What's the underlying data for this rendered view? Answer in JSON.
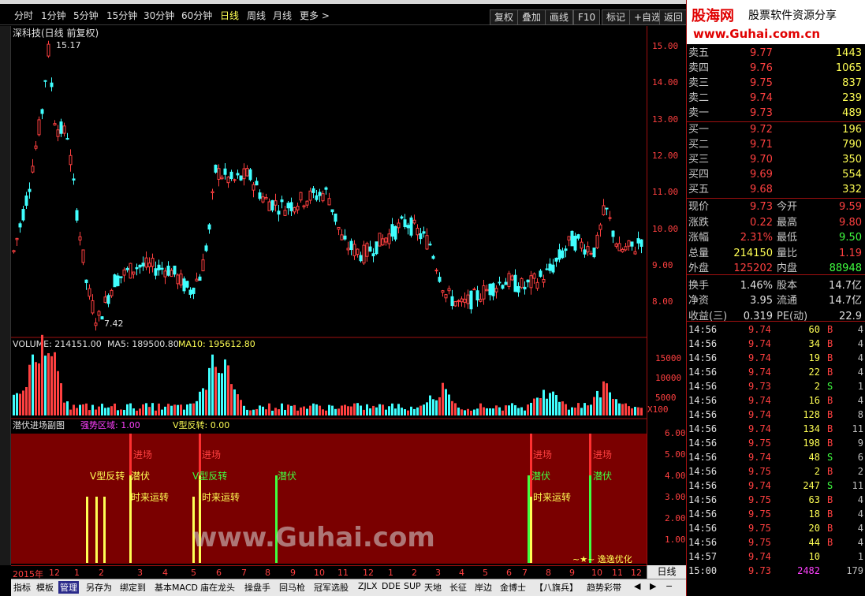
{
  "toolbar": {
    "periods": [
      "分时",
      "1分钟",
      "5分钟",
      "15分钟",
      "30分钟",
      "60分钟",
      "日线",
      "周线",
      "月线",
      "更多 >"
    ],
    "active_period": "日线",
    "right_buttons": [
      "复权",
      "叠加",
      "画线",
      "F10",
      "标记",
      "+自选",
      "返回"
    ]
  },
  "chart": {
    "title": "深科技(日线 前复权)",
    "high_label": "15.17",
    "low_label": "7.42",
    "price_ticks": [
      "15.00",
      "14.00",
      "13.00",
      "12.00",
      "11.00",
      "10.00",
      "9.00",
      "8.00"
    ],
    "volume_header": {
      "volume": "VOLUME: 214151.00",
      "ma5": "MA5: 189500.80",
      "ma10": "MA10: 195612.80"
    },
    "volume_ticks": [
      "15000",
      "10000",
      "5000",
      "X100"
    ],
    "sub_header": {
      "name": "潜伏进场副图",
      "s1": "强势区域: 1.00",
      "s2": "V型反转: 0.00"
    },
    "sub_ticks": [
      "6.00",
      "5.00",
      "4.00",
      "3.00",
      "2.00",
      "1.00"
    ],
    "signals": [
      "进场",
      "进场",
      "进场",
      "进场",
      "潜伏",
      "潜伏",
      "潜伏",
      "潜伏",
      "V型反转",
      "V型反转",
      "时来运转",
      "时来运转",
      "时来运转"
    ],
    "optimize_note": "~★~ 逸逸优化",
    "watermark": "www.Guhai.com",
    "date_labels": [
      "2015年",
      "12",
      "1",
      "2",
      "3",
      "4",
      "5",
      "6",
      "7",
      "8",
      "9",
      "10",
      "11",
      "12",
      "1",
      "2",
      "3",
      "4",
      "5",
      "6",
      "7",
      "8",
      "9",
      "10",
      "11",
      "12"
    ],
    "period_label": "日线"
  },
  "bottom_tabs": [
    "指标",
    "模板",
    "管理",
    "另存为",
    "绑定到",
    "基本MACD",
    "庙在龙头",
    "操盘手",
    "回马枪",
    "冠军选股",
    "ZJLX",
    "DDE",
    "SUP",
    "天地",
    "长征",
    "岸边",
    "金博士",
    "【八旗兵】",
    "趋势彩带"
  ],
  "active_bottom_tab": "管理",
  "ad": {
    "brand": "股海网",
    "slogan": "股票软件资源分享",
    "url": "www.Guhai.com.cn"
  },
  "orderbook": {
    "asks": [
      {
        "label": "卖五",
        "price": "9.77",
        "vol": "1443"
      },
      {
        "label": "卖四",
        "price": "9.76",
        "vol": "1065"
      },
      {
        "label": "卖三",
        "price": "9.75",
        "vol": "837"
      },
      {
        "label": "卖二",
        "price": "9.74",
        "vol": "239"
      },
      {
        "label": "卖一",
        "price": "9.73",
        "vol": "489"
      }
    ],
    "bids": [
      {
        "label": "买一",
        "price": "9.72",
        "vol": "196"
      },
      {
        "label": "买二",
        "price": "9.71",
        "vol": "790"
      },
      {
        "label": "买三",
        "price": "9.70",
        "vol": "350"
      },
      {
        "label": "买四",
        "price": "9.69",
        "vol": "554"
      },
      {
        "label": "买五",
        "price": "9.68",
        "vol": "332"
      }
    ]
  },
  "stats": [
    {
      "k1": "现价",
      "v1": "9.73",
      "c1": "#ff4040",
      "k2": "今开",
      "v2": "9.59",
      "c2": "#ff4040"
    },
    {
      "k1": "涨跌",
      "v1": "0.22",
      "c1": "#ff4040",
      "k2": "最高",
      "v2": "9.80",
      "c2": "#ff4040"
    },
    {
      "k1": "涨幅",
      "v1": "2.31%",
      "c1": "#ff4040",
      "k2": "最低",
      "v2": "9.50",
      "c2": "#40ff40"
    },
    {
      "k1": "总量",
      "v1": "214150",
      "c1": "#ffff54",
      "k2": "量比",
      "v2": "1.19",
      "c2": "#ff4040"
    },
    {
      "k1": "外盘",
      "v1": "125202",
      "c1": "#ff4040",
      "k2": "内盘",
      "v2": "88948",
      "c2": "#40ff40"
    },
    {
      "k1": "换手",
      "v1": "1.46%",
      "c1": "#e0e0e0",
      "k2": "股本",
      "v2": "14.7亿",
      "c2": "#e0e0e0"
    },
    {
      "k1": "净资",
      "v1": "3.95",
      "c1": "#e0e0e0",
      "k2": "流通",
      "v2": "14.7亿",
      "c2": "#e0e0e0"
    },
    {
      "k1": "收益(三)",
      "v1": "0.319",
      "c1": "#e0e0e0",
      "k2": "PE(动)",
      "v2": "22.9",
      "c2": "#e0e0e0"
    }
  ],
  "ticks": [
    {
      "t": "14:56",
      "p": "9.74",
      "v": "60",
      "d": "B",
      "n": "4"
    },
    {
      "t": "14:56",
      "p": "9.74",
      "v": "34",
      "d": "B",
      "n": "4"
    },
    {
      "t": "14:56",
      "p": "9.74",
      "v": "19",
      "d": "B",
      "n": "4"
    },
    {
      "t": "14:56",
      "p": "9.74",
      "v": "22",
      "d": "B",
      "n": "4"
    },
    {
      "t": "14:56",
      "p": "9.73",
      "v": "2",
      "d": "S",
      "n": "1"
    },
    {
      "t": "14:56",
      "p": "9.74",
      "v": "16",
      "d": "B",
      "n": "4"
    },
    {
      "t": "14:56",
      "p": "9.74",
      "v": "128",
      "d": "B",
      "n": "8"
    },
    {
      "t": "14:56",
      "p": "9.74",
      "v": "134",
      "d": "B",
      "n": "11"
    },
    {
      "t": "14:56",
      "p": "9.75",
      "v": "198",
      "d": "B",
      "n": "9"
    },
    {
      "t": "14:56",
      "p": "9.74",
      "v": "48",
      "d": "S",
      "n": "6"
    },
    {
      "t": "14:56",
      "p": "9.75",
      "v": "2",
      "d": "B",
      "n": "2"
    },
    {
      "t": "14:56",
      "p": "9.74",
      "v": "247",
      "d": "S",
      "n": "11"
    },
    {
      "t": "14:56",
      "p": "9.75",
      "v": "63",
      "d": "B",
      "n": "4"
    },
    {
      "t": "14:56",
      "p": "9.75",
      "v": "18",
      "d": "B",
      "n": "4"
    },
    {
      "t": "14:56",
      "p": "9.75",
      "v": "20",
      "d": "B",
      "n": "4"
    },
    {
      "t": "14:56",
      "p": "9.75",
      "v": "44",
      "d": "B",
      "n": "4"
    },
    {
      "t": "14:57",
      "p": "9.74",
      "v": "10",
      "d": "",
      "n": "1"
    },
    {
      "t": "15:00",
      "p": "9.73",
      "v": "2482",
      "d": "",
      "n": "179"
    }
  ],
  "colors": {
    "up": "#ff4040",
    "down": "#40ffff",
    "yellow": "#ffff54",
    "green": "#40ff40",
    "frame": "#a01010"
  }
}
